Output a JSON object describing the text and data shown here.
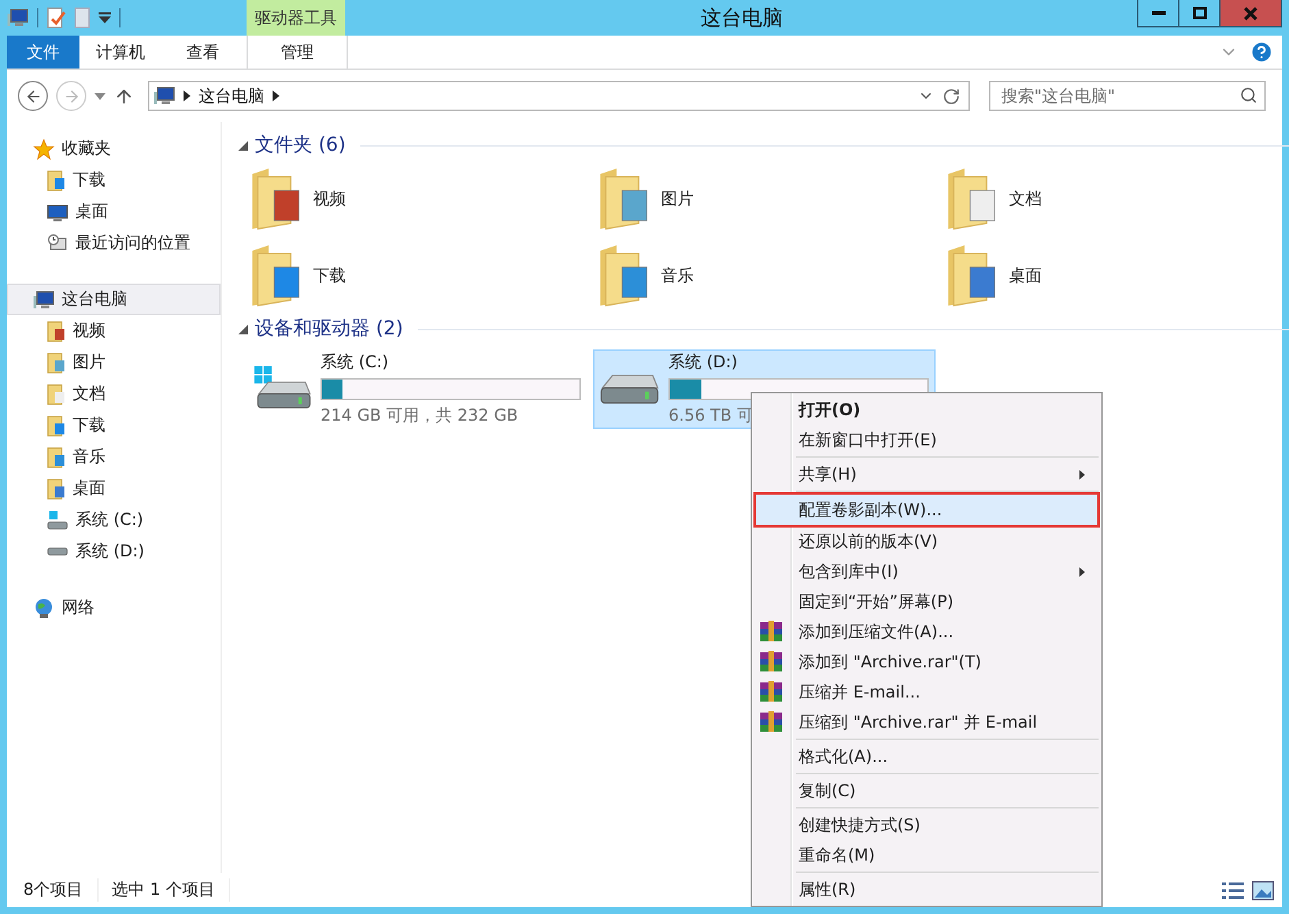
{
  "window": {
    "title": "这台电脑",
    "context_group": "驱动器工具"
  },
  "ribbon_tabs": [
    {
      "label": "文件",
      "kind": "file",
      "selected": false
    },
    {
      "label": "计算机",
      "kind": "tab",
      "selected": false
    },
    {
      "label": "查看",
      "kind": "tab",
      "selected": false
    },
    {
      "label": "管理",
      "kind": "context",
      "selected": false
    }
  ],
  "address": {
    "breadcrumb": [
      "这台电脑"
    ]
  },
  "search": {
    "placeholder": "搜索\"这台电脑\""
  },
  "sidebar": [
    {
      "label": "收藏夹",
      "selected": false,
      "children": [
        {
          "label": "下载",
          "selected": false
        },
        {
          "label": "桌面",
          "selected": false
        },
        {
          "label": "最近访问的位置",
          "selected": false
        }
      ]
    },
    {
      "label": "这台电脑",
      "selected": true,
      "children": [
        {
          "label": "视频",
          "selected": false
        },
        {
          "label": "图片",
          "selected": false
        },
        {
          "label": "文档",
          "selected": false
        },
        {
          "label": "下载",
          "selected": false
        },
        {
          "label": "音乐",
          "selected": false
        },
        {
          "label": "桌面",
          "selected": false
        },
        {
          "label": "系统 (C:)",
          "selected": false
        },
        {
          "label": "系统 (D:)",
          "selected": false
        }
      ]
    },
    {
      "label": "网络",
      "selected": false
    }
  ],
  "folders": {
    "header": "文件夹 (6)",
    "expanded": true,
    "items": [
      {
        "label": "视频"
      },
      {
        "label": "图片"
      },
      {
        "label": "文档"
      },
      {
        "label": "下载"
      },
      {
        "label": "音乐"
      },
      {
        "label": "桌面"
      }
    ]
  },
  "drives": {
    "header": "设备和驱动器 (2)",
    "expanded": true,
    "items": [
      {
        "name": "系统 (C:)",
        "level": 0.08,
        "info": "214 GB 可用，共 232 GB",
        "selected": false
      },
      {
        "name": "系统 (D:)",
        "level": 0.12,
        "info": "6.56 TB 可",
        "selected": true
      }
    ]
  },
  "context_menu": [
    {
      "kind": "item",
      "label": "打开(O)",
      "default": true,
      "submenu": false,
      "selected": false
    },
    {
      "kind": "item",
      "label": "在新窗口中打开(E)",
      "default": false,
      "submenu": false,
      "selected": false
    },
    {
      "kind": "separator"
    },
    {
      "kind": "item",
      "label": "共享(H)",
      "default": false,
      "submenu": true,
      "selected": false
    },
    {
      "kind": "separator"
    },
    {
      "kind": "item",
      "label": "配置卷影副本(W)...",
      "default": false,
      "submenu": false,
      "selected": true
    },
    {
      "kind": "item",
      "label": "还原以前的版本(V)",
      "default": false,
      "submenu": false,
      "selected": false
    },
    {
      "kind": "item",
      "label": "包含到库中(I)",
      "default": false,
      "submenu": true,
      "selected": false
    },
    {
      "kind": "item",
      "label": "固定到“开始”屏幕(P)",
      "default": false,
      "submenu": false,
      "selected": false
    },
    {
      "kind": "rar",
      "label": "添加到压缩文件(A)...",
      "default": false,
      "submenu": false,
      "selected": false
    },
    {
      "kind": "rar",
      "label": "添加到 \"Archive.rar\"(T)",
      "default": false,
      "submenu": false,
      "selected": false
    },
    {
      "kind": "rar",
      "label": "压缩并 E-mail...",
      "default": false,
      "submenu": false,
      "selected": false
    },
    {
      "kind": "rar",
      "label": "压缩到 \"Archive.rar\" 并 E-mail",
      "default": false,
      "submenu": false,
      "selected": false
    },
    {
      "kind": "separator"
    },
    {
      "kind": "item",
      "label": "格式化(A)...",
      "default": false,
      "submenu": false,
      "selected": false
    },
    {
      "kind": "separator"
    },
    {
      "kind": "item",
      "label": "复制(C)",
      "default": false,
      "submenu": false,
      "selected": false
    },
    {
      "kind": "separator"
    },
    {
      "kind": "item",
      "label": "创建快捷方式(S)",
      "default": false,
      "submenu": false,
      "selected": false
    },
    {
      "kind": "item",
      "label": "重命名(M)",
      "default": false,
      "submenu": false,
      "selected": false
    },
    {
      "kind": "separator"
    },
    {
      "kind": "item",
      "label": "属性(R)",
      "default": false,
      "submenu": false,
      "selected": false
    }
  ],
  "status_bar": {
    "items": [
      "8个项目",
      "选中 1 个项目"
    ]
  }
}
